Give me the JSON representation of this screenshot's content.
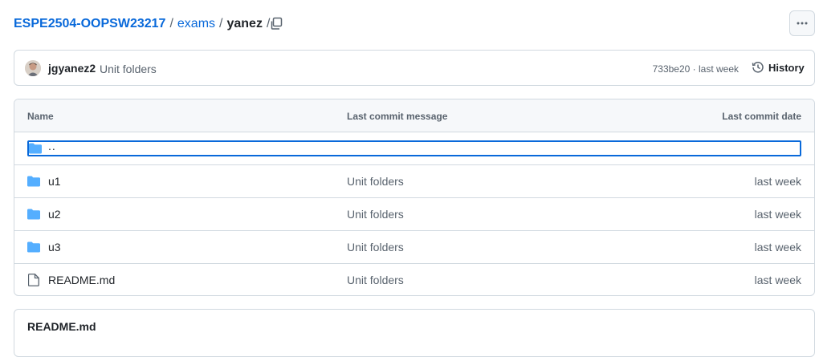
{
  "breadcrumb": {
    "repo": "ESPE2504-OOPSW23217",
    "folder": "exams",
    "current": "yanez",
    "separator": "/"
  },
  "commit": {
    "author": "jgyanez2",
    "message": "Unit folders",
    "meta": "733be20 · last week",
    "history_label": "History"
  },
  "table": {
    "headers": {
      "name": "Name",
      "message": "Last commit message",
      "date": "Last commit date"
    },
    "parent": "..",
    "rows": [
      {
        "name": "u1",
        "type": "folder",
        "message": "Unit folders",
        "date": "last week"
      },
      {
        "name": "u2",
        "type": "folder",
        "message": "Unit folders",
        "date": "last week"
      },
      {
        "name": "u3",
        "type": "folder",
        "message": "Unit folders",
        "date": "last week"
      },
      {
        "name": "README.md",
        "type": "file",
        "message": "Unit folders",
        "date": "last week"
      }
    ]
  },
  "readme": {
    "title": "README.md"
  },
  "colors": {
    "link": "#0969da",
    "folder": "#54aeff",
    "border": "#d1d9e0",
    "muted": "#59636e"
  }
}
